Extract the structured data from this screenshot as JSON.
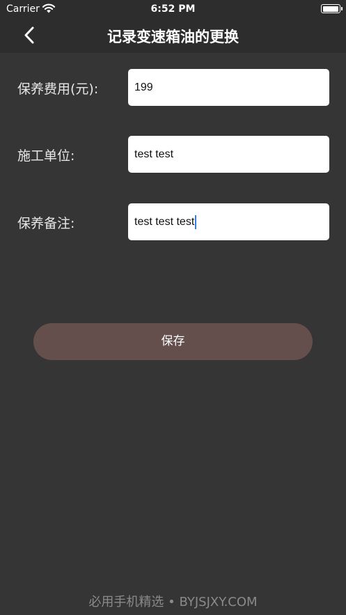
{
  "status_bar": {
    "carrier": "Carrier",
    "time": "6:52 PM",
    "battery_level": 1.0
  },
  "nav": {
    "back_icon": "chevron-left-icon",
    "title": "记录变速箱油的更换"
  },
  "form": {
    "fields": [
      {
        "label": "保养费用(元):",
        "value": "199"
      },
      {
        "label": "施工单位:",
        "value": "test test"
      },
      {
        "label": "保养备注:",
        "value": "test test test"
      }
    ]
  },
  "actions": {
    "save_label": "保存"
  },
  "watermark": "必用手机精选 • BYJSJXY.COM",
  "colors": {
    "background": "#353535",
    "bar_background": "#2d2d2d",
    "save_button": "#654f4d",
    "input_background": "#ffffff",
    "caret": "#3b7bdc",
    "watermark": "#8a8a8a"
  }
}
